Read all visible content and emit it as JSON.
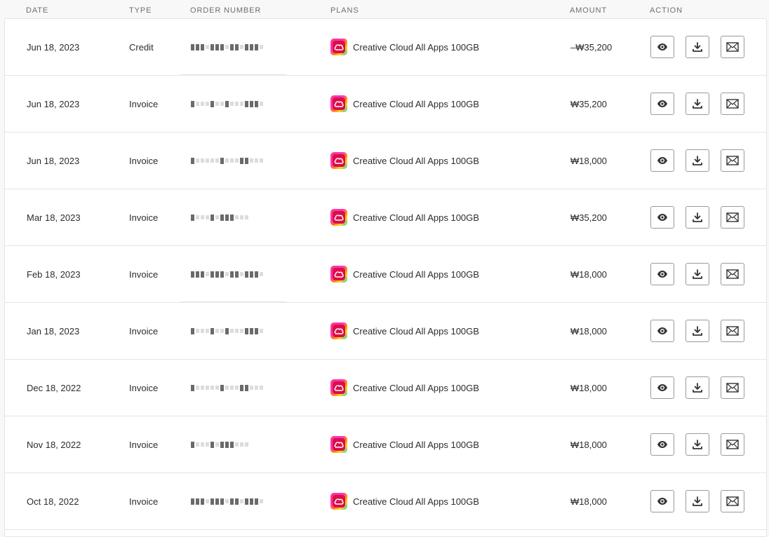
{
  "header": {
    "date": "DATE",
    "type": "TYPE",
    "order_number": "ORDER NUMBER",
    "plans": "PLANS",
    "amount": "AMOUNT",
    "action": "ACTION"
  },
  "rows": [
    {
      "date": "Jun 18, 2023",
      "type": "Credit",
      "plan": "Creative Cloud All Apps 100GB",
      "amount": "–₩35,200"
    },
    {
      "date": "Jun 18, 2023",
      "type": "Invoice",
      "plan": "Creative Cloud All Apps 100GB",
      "amount": "₩35,200"
    },
    {
      "date": "Jun 18, 2023",
      "type": "Invoice",
      "plan": "Creative Cloud All Apps 100GB",
      "amount": "₩18,000"
    },
    {
      "date": "Mar 18, 2023",
      "type": "Invoice",
      "plan": "Creative Cloud All Apps 100GB",
      "amount": "₩35,200"
    },
    {
      "date": "Feb 18, 2023",
      "type": "Invoice",
      "plan": "Creative Cloud All Apps 100GB",
      "amount": "₩18,000"
    },
    {
      "date": "Jan 18, 2023",
      "type": "Invoice",
      "plan": "Creative Cloud All Apps 100GB",
      "amount": "₩18,000"
    },
    {
      "date": "Dec 18, 2022",
      "type": "Invoice",
      "plan": "Creative Cloud All Apps 100GB",
      "amount": "₩18,000"
    },
    {
      "date": "Nov 18, 2022",
      "type": "Invoice",
      "plan": "Creative Cloud All Apps 100GB",
      "amount": "₩18,000"
    },
    {
      "date": "Oct 18, 2022",
      "type": "Invoice",
      "plan": "Creative Cloud All Apps 100GB",
      "amount": "₩18,000"
    }
  ],
  "icons": {
    "view": "eye-icon",
    "download": "download-icon",
    "email": "envelope-icon",
    "plan": "creative-cloud-logo-icon"
  },
  "colors": {
    "border": "#e4e4e4",
    "button_border": "#9a9a9a",
    "header_text": "#6e6e6e"
  }
}
